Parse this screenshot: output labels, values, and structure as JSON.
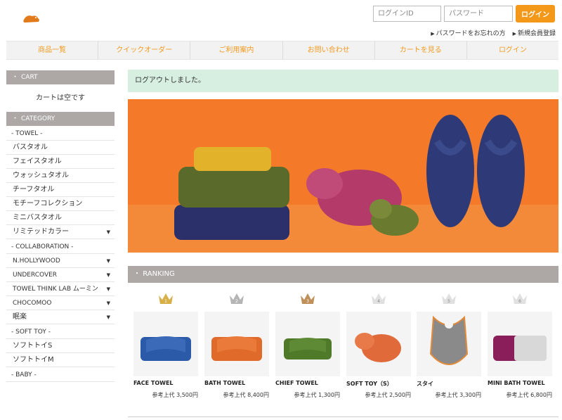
{
  "header": {
    "login_id_placeholder": "ログインID",
    "password_placeholder": "パスワード",
    "login_button": "ログイン",
    "forgot_password": "パスワードをお忘れの方",
    "new_member": "新規会員登録"
  },
  "nav": {
    "items": [
      "商品一覧",
      "クイックオーダー",
      "ご利用案内",
      "お問い合わせ",
      "カートを見る",
      "ログイン"
    ]
  },
  "sidebar": {
    "cart_title": "CART",
    "cart_empty": "カートは空です",
    "category_title": "CATEGORY",
    "groups": [
      {
        "label": "- TOWEL -",
        "items": [
          "バスタオル",
          "フェイスタオル",
          "ウォッシュタオル",
          "チーフタオル",
          "モチーフコレクション",
          "ミニバスタオル",
          "リミテッドカラー"
        ]
      },
      {
        "label": "- COLLABORATION -",
        "items": [
          "N.HOLLYWOOD",
          "UNDERCOVER",
          "TOWEL THINK LAB ムーミン",
          "CHOCOMOO",
          "眠楽"
        ]
      },
      {
        "label": "- SOFT TOY -",
        "items": [
          "ソフトトイS",
          "ソフトトイM"
        ]
      },
      {
        "label": "- BABY -",
        "items": []
      }
    ]
  },
  "main": {
    "notice": "ログアウトしました。",
    "ranking_title": "RANKING",
    "products": [
      {
        "rank": "1",
        "name": "FACE TOWEL",
        "price": "参考上代  3,500円",
        "color": "#2a5aa8"
      },
      {
        "rank": "2",
        "name": "BATH TOWEL",
        "price": "参考上代  8,400円",
        "color": "#e06a2a"
      },
      {
        "rank": "3",
        "name": "CHIEF TOWEL",
        "price": "参考上代  1,300円",
        "color": "#4f7a2a"
      },
      {
        "rank": "4",
        "name": "SOFT TOY（S）",
        "price": "参考上代  2,500円",
        "color": "#e06a3a"
      },
      {
        "rank": "5",
        "name": "スタイ",
        "price": "参考上代  3,300円",
        "color": "#8a8a8a"
      },
      {
        "rank": "6",
        "name": "MINI BATH TOWEL",
        "price": "参考上代  6,800円",
        "color": "#8a1e5a"
      }
    ]
  },
  "colors": {
    "accent": "#f39819",
    "sidebar_head": "#ada8a6",
    "notice_bg": "#d7efe0",
    "hero_bg": "#f47a2a"
  }
}
